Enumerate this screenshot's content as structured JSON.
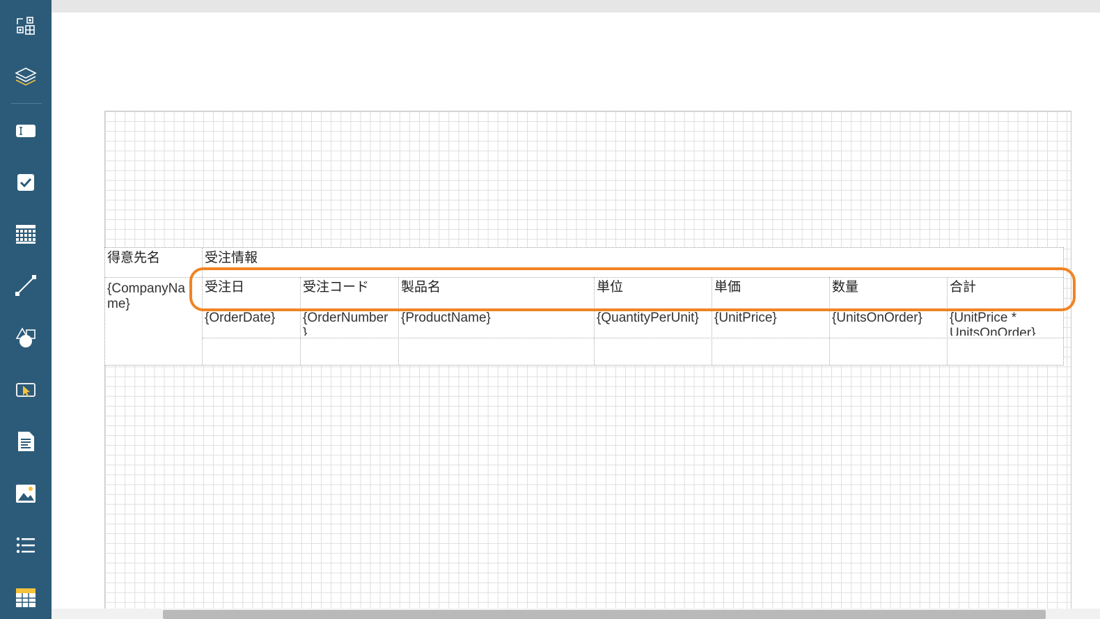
{
  "app": {
    "accent_color": "#2c5b79",
    "highlight_color": "#f08423"
  },
  "sidebar": {
    "items": [
      {
        "name": "components-icon"
      },
      {
        "name": "layers-icon"
      },
      {
        "name": "textbox-icon"
      },
      {
        "name": "checkbox-icon"
      },
      {
        "name": "table-grid-icon"
      },
      {
        "name": "line-icon"
      },
      {
        "name": "shape-icon"
      },
      {
        "name": "input-field-icon"
      },
      {
        "name": "richtext-icon"
      },
      {
        "name": "image-icon"
      },
      {
        "name": "list-icon"
      },
      {
        "name": "tablix-icon"
      }
    ]
  },
  "report": {
    "header_customer": "得意先名",
    "header_order_info": "受注情報",
    "customer_field_line1": "{CompanyNa",
    "customer_field_line2": "me}",
    "columns": [
      {
        "header": "受注日",
        "field": "{OrderDate}",
        "field_line2": ""
      },
      {
        "header": "受注コード",
        "field": "{OrderNumber",
        "field_line2": "}"
      },
      {
        "header": "製品名",
        "field": "{ProductName}",
        "field_line2": ""
      },
      {
        "header": "単位",
        "field": "{QuantityPerUnit}",
        "field_line2": ""
      },
      {
        "header": "単価",
        "field": "{UnitPrice}",
        "field_line2": ""
      },
      {
        "header": "数量",
        "field": "{UnitsOnOrder}",
        "field_line2": ""
      },
      {
        "header": "合計",
        "field": "{UnitPrice *",
        "field_line2": "UnitsOnOrder}"
      }
    ]
  }
}
